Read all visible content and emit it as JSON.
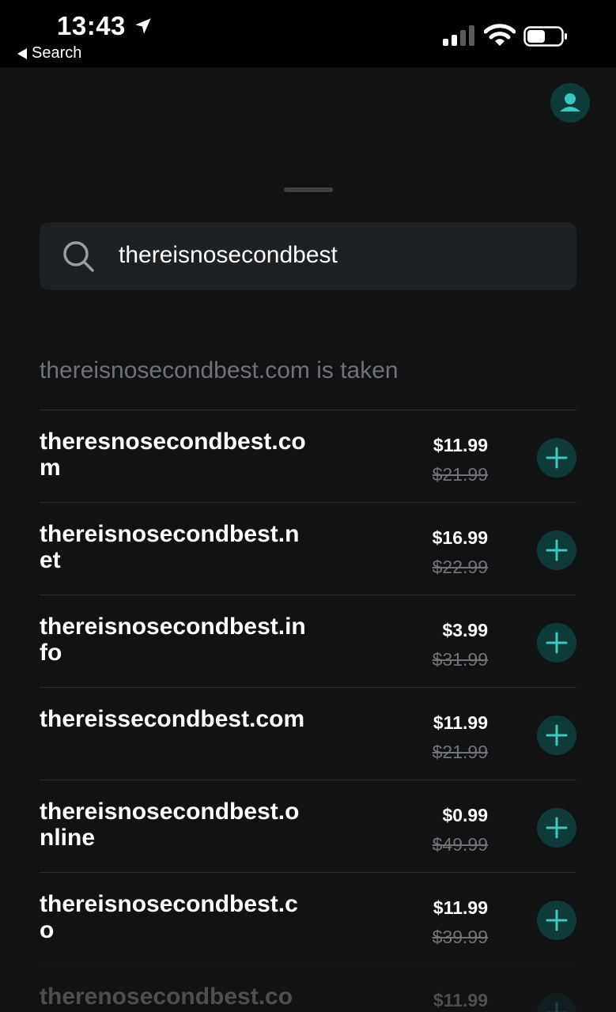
{
  "status_bar": {
    "time": "13:43",
    "back_label": "Search"
  },
  "search": {
    "query": "thereisnosecondbest",
    "taken_message": "thereisnosecondbest.com is taken"
  },
  "results": [
    {
      "domain": "theresnosecondbest.com",
      "price": "$11.99",
      "old_price": "$21.99"
    },
    {
      "domain": "thereisnosecondbest.net",
      "price": "$16.99",
      "old_price": "$22.99"
    },
    {
      "domain": "thereisnosecondbest.info",
      "price": "$3.99",
      "old_price": "$31.99"
    },
    {
      "domain": "thereissecondbest.com",
      "price": "$11.99",
      "old_price": "$21.99"
    },
    {
      "domain": "thereisnosecondbest.online",
      "price": "$0.99",
      "old_price": "$49.99"
    },
    {
      "domain": "thereisnosecondbest.co",
      "price": "$11.99",
      "old_price": "$39.99"
    },
    {
      "domain": "therenosecondbest.com",
      "price": "$11.99",
      "old_price": ""
    }
  ],
  "colors": {
    "accent": "#3ec7c2",
    "accent_bg": "#0f3a3a",
    "background": "#111214"
  }
}
